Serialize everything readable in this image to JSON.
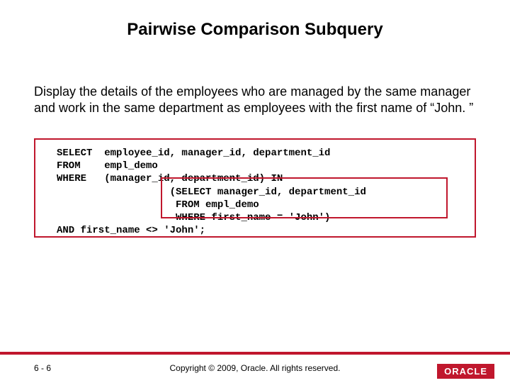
{
  "title": "Pairwise Comparison Subquery",
  "body": "Display the details of the employees who are managed by the same manager and work in the same department as employees with the first name of “John. ”",
  "code": "SELECT  employee_id, manager_id, department_id\nFROM    empl_demo\nWHERE   (manager_id, department_id) IN\n                   (SELECT manager_id, department_id\n                    FROM empl_demo\n                    WHERE first_name = 'John')\nAND first_name <> 'John';",
  "footer": {
    "page": "6 - 6",
    "copyright": "Copyright © 2009, Oracle. All rights reserved.",
    "logo": "ORACLE"
  }
}
